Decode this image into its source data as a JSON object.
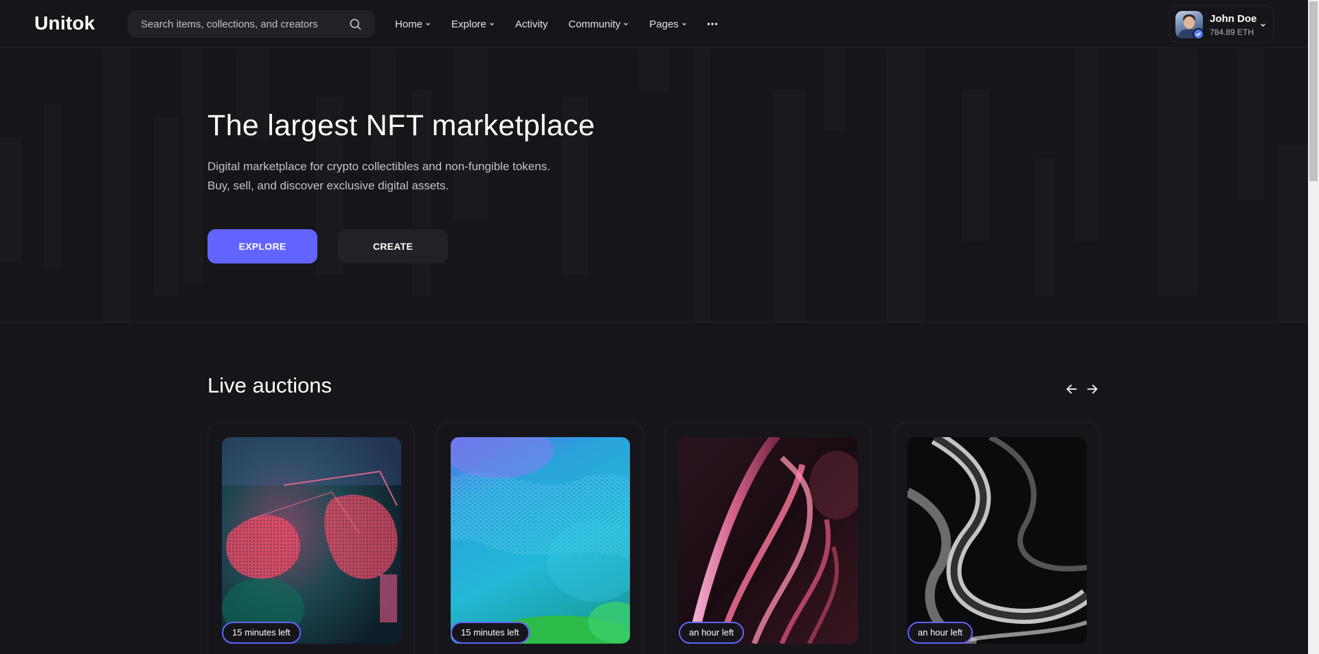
{
  "brand": {
    "name": "Unitok"
  },
  "search": {
    "placeholder": "Search items, collections, and creators",
    "icon": "search-icon"
  },
  "nav": {
    "items": [
      {
        "label": "Home",
        "dropdown": true
      },
      {
        "label": "Explore",
        "dropdown": true
      },
      {
        "label": "Activity",
        "dropdown": false
      },
      {
        "label": "Community",
        "dropdown": true
      },
      {
        "label": "Pages",
        "dropdown": true
      }
    ],
    "more_icon": "more-dots-icon"
  },
  "profile": {
    "name": "John Doe",
    "balance": "784.89 ETH",
    "verified": true
  },
  "hero": {
    "title": "The largest NFT marketplace",
    "description_line1": "Digital marketplace for crypto collectibles and non-fungible tokens.",
    "description_line2": "Buy, sell, and discover exclusive digital assets.",
    "explore_label": "EXPLORE",
    "create_label": "CREATE"
  },
  "auctions": {
    "title": "Live auctions",
    "prev_icon": "arrow-left-icon",
    "next_icon": "arrow-right-icon",
    "cards": [
      {
        "time_left": "15 minutes left"
      },
      {
        "time_left": "15 minutes left"
      },
      {
        "time_left": "an hour left"
      },
      {
        "time_left": "an hour left"
      }
    ]
  },
  "colors": {
    "background": "#16151a",
    "surface": "#222127",
    "accent": "#6164ff",
    "text": "#ffffff",
    "muted": "#c3c3c8"
  }
}
